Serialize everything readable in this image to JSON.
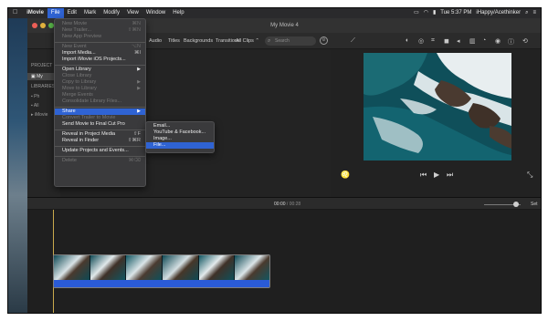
{
  "menubar": {
    "app_name": "iMovie",
    "items": [
      "File",
      "Edit",
      "Mark",
      "Modify",
      "View",
      "Window",
      "Help"
    ],
    "clock": "Tue 5:37 PM",
    "user": "iHappy/Acethinker"
  },
  "window": {
    "title": "My Movie 4"
  },
  "toolbar": {
    "tabs": [
      "Audio",
      "Titles",
      "Backgrounds",
      "Transitions"
    ],
    "clips_filter": "All Clips",
    "search_placeholder": "Search"
  },
  "sidebar": {
    "project_header": "PROJECT",
    "project_item": "My",
    "libraries_header": "LIBRARIES",
    "library_items": [
      "Ph",
      "All",
      "iMovie"
    ]
  },
  "file_menu": {
    "items": [
      {
        "label": "New Movie",
        "shortcut": "⌘N",
        "disabled": true
      },
      {
        "label": "New Trailer...",
        "shortcut": "⇧⌘N",
        "disabled": true
      },
      {
        "label": "New App Preview",
        "shortcut": "",
        "disabled": true
      },
      {
        "sep": true
      },
      {
        "label": "New Event",
        "shortcut": "⌥N",
        "disabled": true
      },
      {
        "label": "Import Media...",
        "shortcut": "⌘I",
        "disabled": false
      },
      {
        "label": "Import iMovie iOS Projects...",
        "shortcut": "",
        "disabled": false
      },
      {
        "sep": true
      },
      {
        "label": "Open Library",
        "shortcut": "",
        "disabled": false,
        "submenu": true
      },
      {
        "label": "Close Library",
        "shortcut": "",
        "disabled": true
      },
      {
        "label": "Copy to Library",
        "shortcut": "",
        "disabled": true,
        "submenu": true
      },
      {
        "label": "Move to Library",
        "shortcut": "",
        "disabled": true,
        "submenu": true
      },
      {
        "label": "Merge Events",
        "shortcut": "",
        "disabled": true
      },
      {
        "label": "Consolidate Library Files...",
        "shortcut": "",
        "disabled": true
      },
      {
        "sep": true
      },
      {
        "label": "Share",
        "shortcut": "",
        "disabled": false,
        "submenu": true,
        "highlighted": true
      },
      {
        "label": "Convert Trailer to Movie",
        "shortcut": "",
        "disabled": true
      },
      {
        "label": "Send Movie to Final Cut Pro",
        "shortcut": "",
        "disabled": false
      },
      {
        "sep": true
      },
      {
        "label": "Reveal in Project Media",
        "shortcut": "⇧F",
        "disabled": false
      },
      {
        "label": "Reveal in Finder",
        "shortcut": "⇧⌘R",
        "disabled": false
      },
      {
        "sep": true
      },
      {
        "label": "Update Projects and Events...",
        "shortcut": "",
        "disabled": false
      },
      {
        "sep": true
      },
      {
        "label": "Delete",
        "shortcut": "⌘⌫",
        "disabled": true
      }
    ]
  },
  "share_menu": {
    "items": [
      {
        "label": "Email...",
        "highlighted": false
      },
      {
        "label": "YouTube & Facebook...",
        "highlighted": false
      },
      {
        "label": "Image...",
        "highlighted": false
      },
      {
        "label": "File...",
        "highlighted": true
      }
    ]
  },
  "timeline": {
    "current_time": "00:00",
    "separator": "/",
    "total_time": "00:28",
    "settings_label": "Set"
  }
}
